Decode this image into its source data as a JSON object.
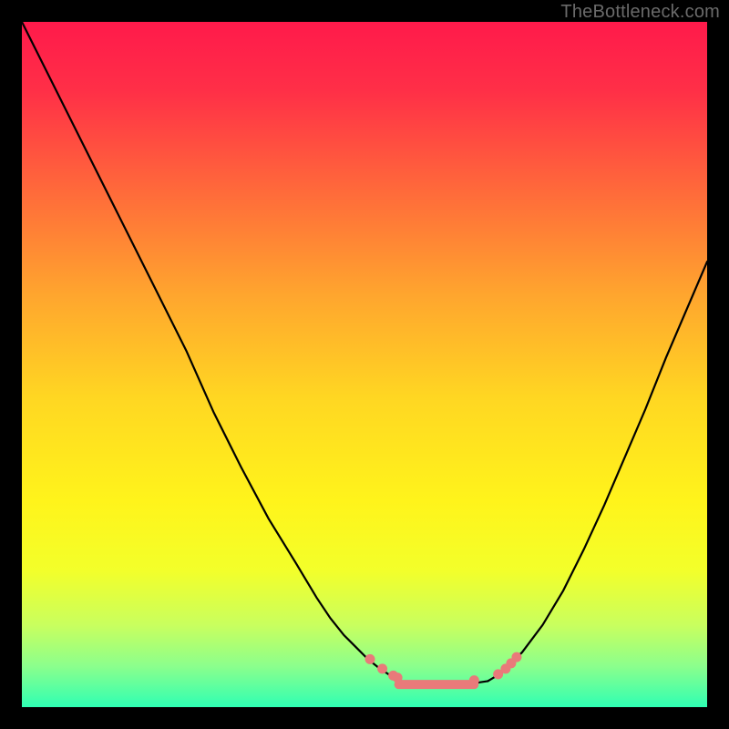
{
  "watermark": "TheBottleneck.com",
  "chart_data": {
    "type": "line",
    "title": "",
    "xlabel": "",
    "ylabel": "",
    "xlim": [
      0,
      100
    ],
    "ylim": [
      0,
      100
    ],
    "grid": false,
    "legend": false,
    "background_gradient": [
      {
        "stop": 0.0,
        "color": "#ff1a4b"
      },
      {
        "stop": 0.1,
        "color": "#ff2f47"
      },
      {
        "stop": 0.25,
        "color": "#ff6b3a"
      },
      {
        "stop": 0.4,
        "color": "#ffa62e"
      },
      {
        "stop": 0.55,
        "color": "#ffd722"
      },
      {
        "stop": 0.7,
        "color": "#fff41b"
      },
      {
        "stop": 0.8,
        "color": "#f3ff2a"
      },
      {
        "stop": 0.88,
        "color": "#c9ff5e"
      },
      {
        "stop": 0.94,
        "color": "#8cff8c"
      },
      {
        "stop": 1.0,
        "color": "#2fffb3"
      }
    ],
    "series": [
      {
        "name": "left-curve",
        "color": "#000000",
        "x": [
          0,
          4,
          9,
          14,
          19,
          24,
          28,
          32,
          36,
          40,
          43,
          45,
          47,
          49,
          50.5,
          52,
          53.5,
          55,
          56
        ],
        "y": [
          100,
          92,
          82,
          72,
          62,
          52,
          43,
          35,
          27.5,
          21,
          16,
          13,
          10.5,
          8.5,
          7,
          5.8,
          4.8,
          4,
          3.5
        ]
      },
      {
        "name": "flat-minimum",
        "color": "#000000",
        "x": [
          56,
          58,
          60,
          62,
          64,
          66,
          68
        ],
        "y": [
          3.5,
          3.3,
          3.2,
          3.2,
          3.3,
          3.5,
          3.8
        ]
      },
      {
        "name": "right-curve",
        "color": "#000000",
        "x": [
          68,
          70,
          73,
          76,
          79,
          82,
          85,
          88,
          91,
          94,
          97,
          100
        ],
        "y": [
          3.8,
          5,
          8,
          12,
          17,
          23,
          29.5,
          36.5,
          43.5,
          51,
          58,
          65
        ]
      }
    ],
    "markers": [
      {
        "name": "left-dots",
        "color": "#e97a7a",
        "x": [
          50.8,
          52.6,
          54.2,
          54.8
        ],
        "y": [
          7.0,
          5.6,
          4.6,
          4.3
        ]
      },
      {
        "name": "right-dots",
        "color": "#e97a7a",
        "x": [
          66.0,
          69.5,
          70.6,
          71.4,
          72.2
        ],
        "y": [
          3.9,
          4.8,
          5.6,
          6.4,
          7.3
        ]
      }
    ],
    "flat_marker_band": {
      "name": "minimum-band",
      "color": "#e97a7a",
      "x_start": 55,
      "x_end": 66,
      "y": 3.3
    }
  }
}
